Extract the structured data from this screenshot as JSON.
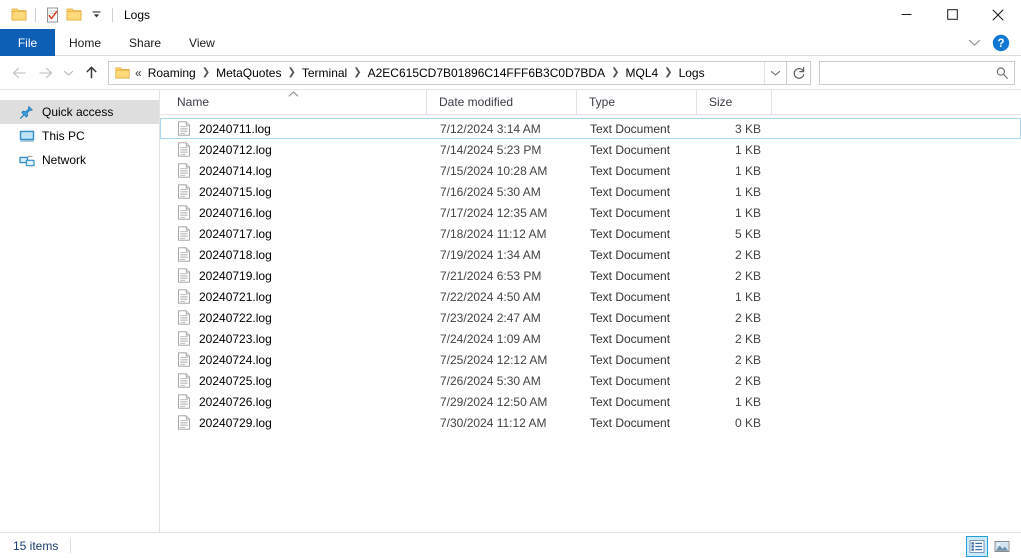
{
  "window": {
    "title": "Logs",
    "quick_access_buttons": [
      {
        "name": "folder-icon",
        "label": "Folder"
      },
      {
        "name": "properties-icon",
        "label": "Properties"
      },
      {
        "name": "new-folder-icon",
        "label": "New folder"
      },
      {
        "name": "customize-dropdown-icon",
        "label": "Customize Quick Access Toolbar"
      }
    ],
    "controls": {
      "minimize": "—",
      "maximize": "□",
      "close": "✕"
    }
  },
  "ribbon": {
    "tabs": [
      {
        "label": "File",
        "active": true
      },
      {
        "label": "Home",
        "active": false
      },
      {
        "label": "Share",
        "active": false
      },
      {
        "label": "View",
        "active": false
      }
    ],
    "expand_label": "Expand the Ribbon",
    "help_label": "Help"
  },
  "navigation": {
    "back_label": "Back",
    "forward_label": "Forward",
    "recent_label": "Recent locations",
    "up_label": "Up",
    "refresh_label": "Refresh",
    "address_dropdown_label": "Previous locations"
  },
  "breadcrumb": {
    "overflow": "«",
    "items": [
      "Roaming",
      "MetaQuotes",
      "Terminal",
      "A2EC615CD7B01896C14FFF6B3C0D7BDA",
      "MQL4",
      "Logs"
    ]
  },
  "search": {
    "value": "",
    "placeholder": ""
  },
  "sidebar": {
    "items": [
      {
        "label": "Quick access",
        "icon": "pin-icon",
        "selected": true
      },
      {
        "label": "This PC",
        "icon": "monitor-icon",
        "selected": false
      },
      {
        "label": "Network",
        "icon": "network-icon",
        "selected": false
      }
    ]
  },
  "columns": {
    "name": "Name",
    "date_modified": "Date modified",
    "type": "Type",
    "size": "Size",
    "sort": {
      "column": "Name",
      "direction": "ascending"
    }
  },
  "files": [
    {
      "name": "20240711.log",
      "date": "7/12/2024 3:14 AM",
      "type": "Text Document",
      "size": "3 KB",
      "focused": true
    },
    {
      "name": "20240712.log",
      "date": "7/14/2024 5:23 PM",
      "type": "Text Document",
      "size": "1 KB",
      "focused": false
    },
    {
      "name": "20240714.log",
      "date": "7/15/2024 10:28 AM",
      "type": "Text Document",
      "size": "1 KB",
      "focused": false
    },
    {
      "name": "20240715.log",
      "date": "7/16/2024 5:30 AM",
      "type": "Text Document",
      "size": "1 KB",
      "focused": false
    },
    {
      "name": "20240716.log",
      "date": "7/17/2024 12:35 AM",
      "type": "Text Document",
      "size": "1 KB",
      "focused": false
    },
    {
      "name": "20240717.log",
      "date": "7/18/2024 11:12 AM",
      "type": "Text Document",
      "size": "5 KB",
      "focused": false
    },
    {
      "name": "20240718.log",
      "date": "7/19/2024 1:34 AM",
      "type": "Text Document",
      "size": "2 KB",
      "focused": false
    },
    {
      "name": "20240719.log",
      "date": "7/21/2024 6:53 PM",
      "type": "Text Document",
      "size": "2 KB",
      "focused": false
    },
    {
      "name": "20240721.log",
      "date": "7/22/2024 4:50 AM",
      "type": "Text Document",
      "size": "1 KB",
      "focused": false
    },
    {
      "name": "20240722.log",
      "date": "7/23/2024 2:47 AM",
      "type": "Text Document",
      "size": "2 KB",
      "focused": false
    },
    {
      "name": "20240723.log",
      "date": "7/24/2024 1:09 AM",
      "type": "Text Document",
      "size": "2 KB",
      "focused": false
    },
    {
      "name": "20240724.log",
      "date": "7/25/2024 12:12 AM",
      "type": "Text Document",
      "size": "2 KB",
      "focused": false
    },
    {
      "name": "20240725.log",
      "date": "7/26/2024 5:30 AM",
      "type": "Text Document",
      "size": "2 KB",
      "focused": false
    },
    {
      "name": "20240726.log",
      "date": "7/29/2024 12:50 AM",
      "type": "Text Document",
      "size": "1 KB",
      "focused": false
    },
    {
      "name": "20240729.log",
      "date": "7/30/2024 11:12 AM",
      "type": "Text Document",
      "size": "0 KB",
      "focused": false
    }
  ],
  "status": {
    "item_count": "15 items",
    "views": [
      {
        "name": "details-view-button",
        "label": "Details view",
        "active": true
      },
      {
        "name": "large-icons-view-button",
        "label": "Large icons view",
        "active": false
      }
    ]
  },
  "colors": {
    "accent": "#0d5fb5",
    "selection": "#cdeafb",
    "status_text": "#1a3c6e",
    "folder": "#ffd04d"
  }
}
